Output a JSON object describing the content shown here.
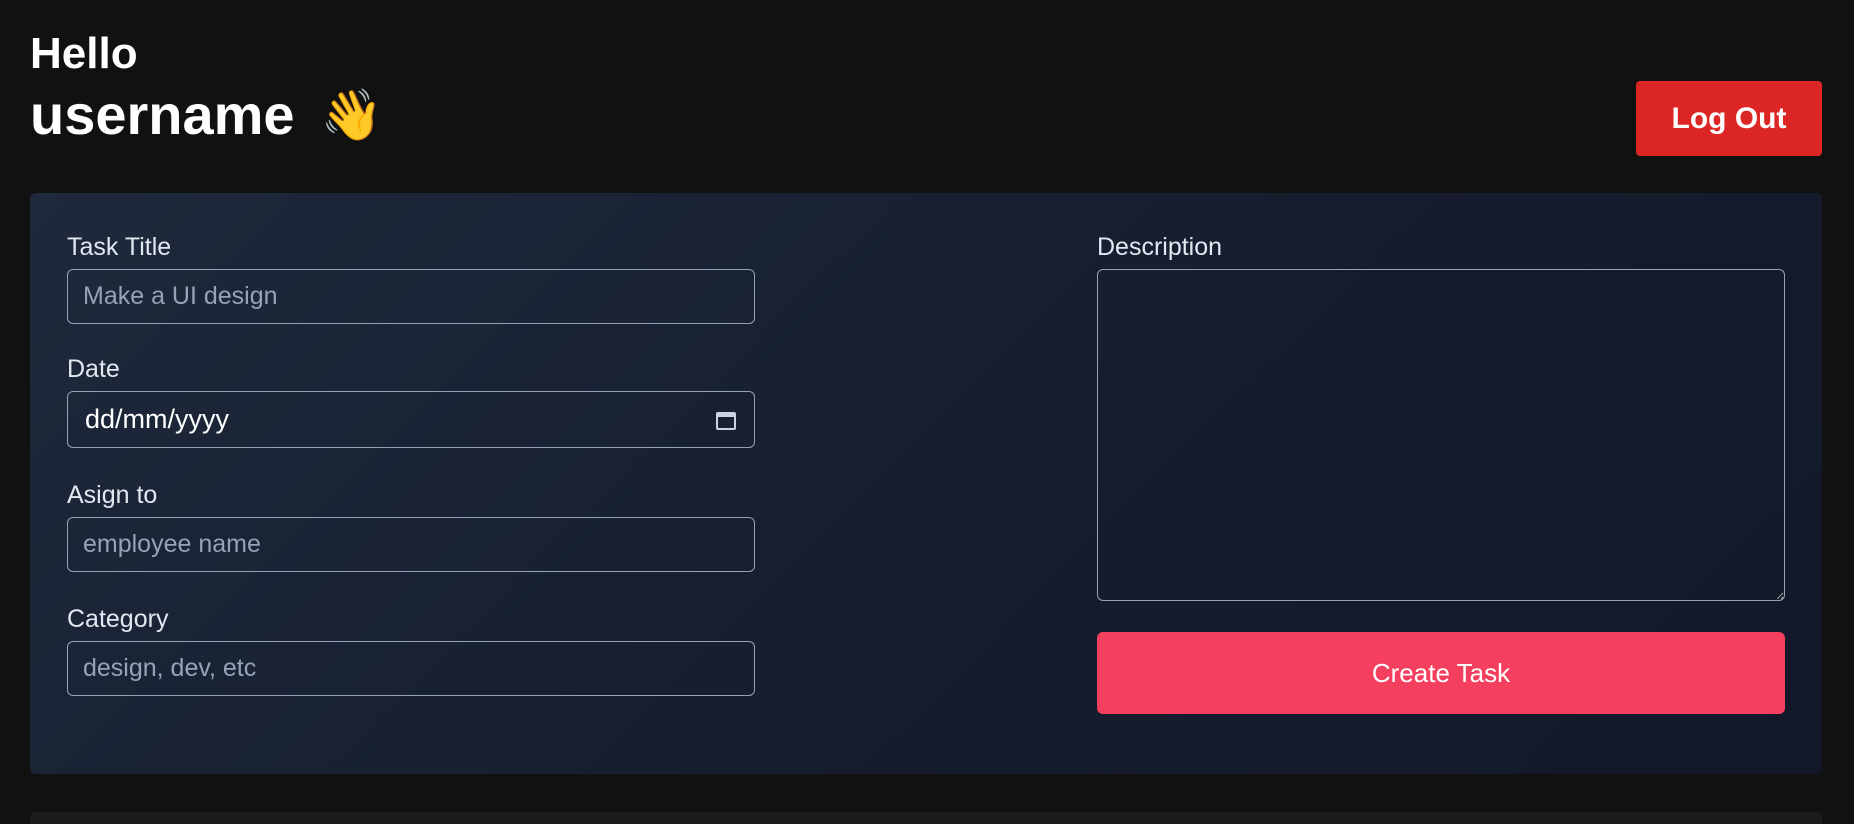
{
  "header": {
    "greeting": "Hello",
    "username": "username",
    "wave_emoji": "👋",
    "logout_label": "Log Out"
  },
  "form": {
    "task_title": {
      "label": "Task Title",
      "placeholder": "Make a UI design",
      "value": ""
    },
    "date": {
      "label": "Date",
      "display": "dd/mm/yyyy"
    },
    "assign_to": {
      "label": "Asign to",
      "placeholder": "employee name",
      "value": ""
    },
    "category": {
      "label": "Category",
      "placeholder": "design, dev, etc",
      "value": ""
    },
    "description": {
      "label": "Description",
      "value": ""
    },
    "submit_label": "Create Task"
  },
  "colors": {
    "background": "#111111",
    "panel": "#1e293b",
    "logout": "#dc2626",
    "create": "#f43f5e"
  },
  "icons": {
    "date_picker": "calendar-icon",
    "greeting": "waving-hand-icon"
  }
}
